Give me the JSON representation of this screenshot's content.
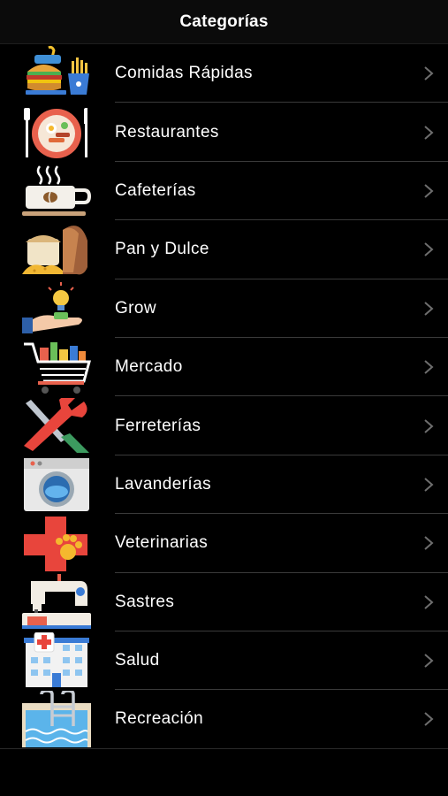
{
  "header": {
    "title": "Categorías"
  },
  "categories": [
    {
      "label": "Comidas Rápidas",
      "icon": "fast-food-icon"
    },
    {
      "label": "Restaurantes",
      "icon": "plate-meal-icon"
    },
    {
      "label": "Cafeterías",
      "icon": "coffee-cup-icon"
    },
    {
      "label": "Pan y Dulce",
      "icon": "bread-icon"
    },
    {
      "label": "Grow",
      "icon": "hand-lightbulb-icon"
    },
    {
      "label": "Mercado",
      "icon": "shopping-cart-icon"
    },
    {
      "label": "Ferreterías",
      "icon": "tools-icon"
    },
    {
      "label": "Lavanderías",
      "icon": "washing-machine-icon"
    },
    {
      "label": "Veterinarias",
      "icon": "vet-cross-paw-icon"
    },
    {
      "label": "Sastres",
      "icon": "sewing-machine-icon"
    },
    {
      "label": "Salud",
      "icon": "hospital-icon"
    },
    {
      "label": "Recreación",
      "icon": "swimming-pool-icon"
    }
  ],
  "colors": {
    "background": "#000000",
    "separator": "#3a3a3a",
    "chevron": "#6e6e6e",
    "text": "#ffffff"
  }
}
